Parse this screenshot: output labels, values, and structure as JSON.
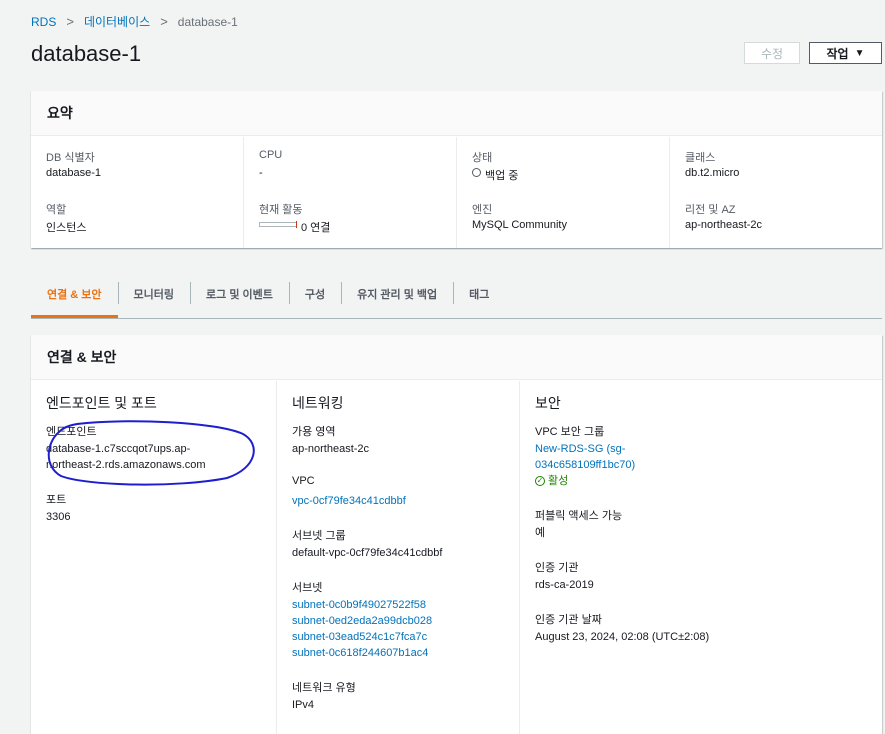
{
  "breadcrumb": {
    "items": [
      "RDS",
      "데이터베이스",
      "database-1"
    ],
    "separator": ">"
  },
  "page": {
    "title": "database-1"
  },
  "actions": {
    "edit_label": "수정",
    "actions_label": "작업",
    "actions_caret": "▼"
  },
  "summary": {
    "title": "요약",
    "columns": [
      [
        {
          "label": "DB 식별자",
          "value": "database-1"
        },
        {
          "label": "역할",
          "value": "인스턴스"
        }
      ],
      [
        {
          "label": "CPU",
          "value": "-"
        },
        {
          "label": "현재 활동",
          "value": "0 연결"
        }
      ],
      [
        {
          "label": "상태",
          "value": "백업 중"
        },
        {
          "label": "엔진",
          "value": "MySQL Community"
        }
      ],
      [
        {
          "label": "클래스",
          "value": "db.t2.micro"
        },
        {
          "label": "리전 및 AZ",
          "value": "ap-northeast-2c"
        }
      ]
    ]
  },
  "tabs": [
    "연결 & 보안",
    "모니터링",
    "로그 및 이벤트",
    "구성",
    "유지 관리 및 백업",
    "태그"
  ],
  "connectivity": {
    "title": "연결 & 보안",
    "endpoint_section": {
      "title": "엔드포인트 및 포트",
      "endpoint_label": "엔드포인트",
      "endpoint_line1": "database-1.c7sccqot7ups.ap-",
      "endpoint_line2": "northeast-2.rds.amazonaws.com",
      "port_label": "포트",
      "port_value": "3306"
    },
    "networking": {
      "title": "네트워킹",
      "az_label": "가용 영역",
      "az_value": "ap-northeast-2c",
      "vpc_label": "VPC",
      "vpc_value": "vpc-0cf79fe34c41cdbbf",
      "subnet_group_label": "서브넷 그룹",
      "subnet_group_value": "default-vpc-0cf79fe34c41cdbbf",
      "subnets_label": "서브넷",
      "subnets": [
        "subnet-0c0b9f49027522f58",
        "subnet-0ed2eda2a99dcb028",
        "subnet-03ead524c1c7fca7c",
        "subnet-0c618f244607b1ac4"
      ],
      "network_type_label": "네트워크 유형",
      "network_type_value": "IPv4"
    },
    "security": {
      "title": "보안",
      "sg_label": "VPC 보안 그룹",
      "sg_line1": "New-RDS-SG (sg-",
      "sg_line2": "034c658109ff1bc70)",
      "sg_status": "활성",
      "public_label": "퍼블릭 액세스 가능",
      "public_value": "예",
      "ca_label": "인증 기관",
      "ca_value": "rds-ca-2019",
      "ca_date_label": "인증 기관 날짜",
      "ca_date_value": "August 23, 2024, 02:08 (UTC±2:08)"
    }
  },
  "colors": {
    "link": "#0073bb",
    "active_tab": "#ec7211",
    "success": "#1d8102",
    "annotation": "#1e1ecf"
  },
  "icons": {
    "status_backup": "clock-icon",
    "sg_status": "check-circle-icon",
    "caret": "caret-down-icon"
  }
}
